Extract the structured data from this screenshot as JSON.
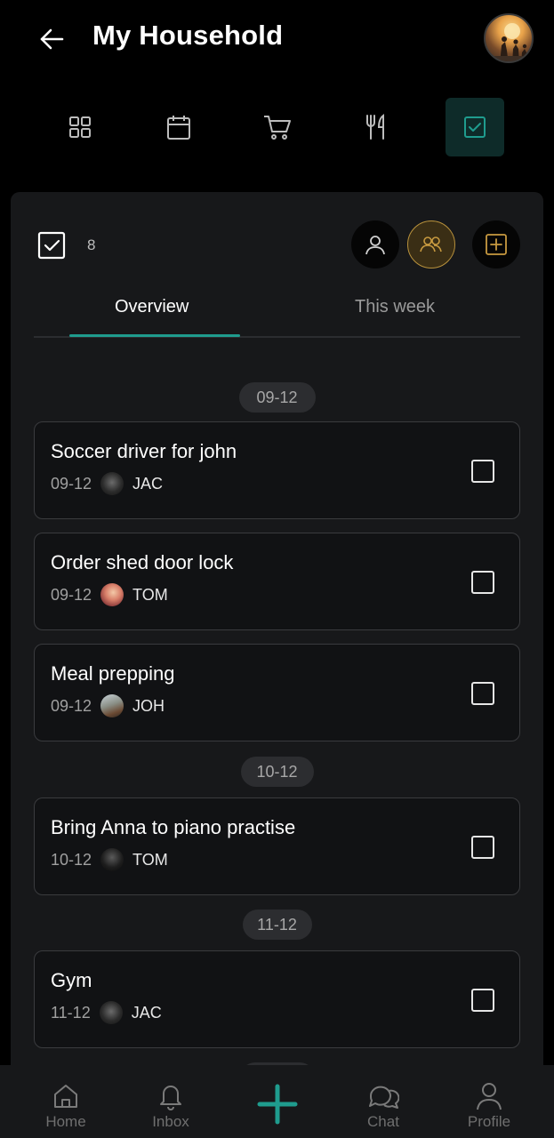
{
  "header": {
    "title": "My Household"
  },
  "nav_icons": [
    {
      "name": "dashboard-grid-icon"
    },
    {
      "name": "calendar-icon"
    },
    {
      "name": "shopping-cart-icon"
    },
    {
      "name": "fork-knife-icon"
    },
    {
      "name": "tasks-checkbox-icon",
      "active": true
    }
  ],
  "panel": {
    "task_count": "8",
    "tabs": {
      "overview": "Overview",
      "this_week": "This week"
    }
  },
  "date_groups": [
    {
      "date": "09-12"
    },
    {
      "date": "10-12"
    },
    {
      "date": "11-12"
    }
  ],
  "tasks": [
    {
      "title": "Soccer driver for john",
      "date": "09-12",
      "person": "JAC"
    },
    {
      "title": "Order shed door lock",
      "date": "09-12",
      "person": "TOM"
    },
    {
      "title": "Meal prepping",
      "date": "09-12",
      "person": "JOH"
    },
    {
      "title": "Bring Anna to piano practise",
      "date": "10-12",
      "person": "TOM"
    },
    {
      "title": "Gym",
      "date": "11-12",
      "person": "JAC"
    }
  ],
  "bottom_nav": {
    "home": "Home",
    "inbox": "Inbox",
    "chat": "Chat",
    "profile": "Profile"
  },
  "colors": {
    "accent": "#1f9c8e",
    "selected_gold": "#b8913c",
    "panel": "#17181a"
  }
}
